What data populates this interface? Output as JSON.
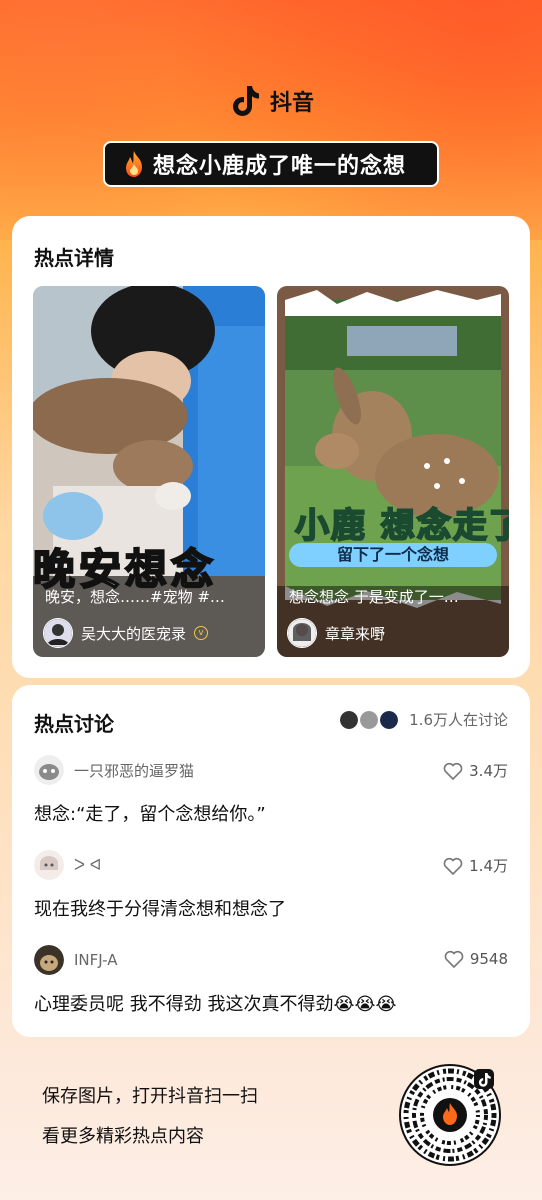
{
  "app": {
    "name": "抖音"
  },
  "topic": {
    "title": "想念小鹿成了唯一的念想"
  },
  "hot_detail": {
    "title": "热点详情",
    "videos": [
      {
        "caption": "晚安，想念……#宠物 #…",
        "overlay": "晚安想念",
        "author": "吴大大的医宠录"
      },
      {
        "caption": "想念想念 于是变成了一…",
        "overlay": "小鹿 想念走了",
        "subtitle": "留下了一个念想",
        "author": "章章来嘢"
      }
    ]
  },
  "discussion": {
    "title": "热点讨论",
    "count_text": "1.6万人在讨论",
    "comments": [
      {
        "user": "一只邪恶的逼罗猫",
        "text": "想念:“走了，留个念想给你。”",
        "likes": "3.4万"
      },
      {
        "user": "ᐳ ᐊ",
        "text": "现在我终于分得清念想和想念了",
        "likes": "1.4万"
      },
      {
        "user": "INFJ-A",
        "text": "心理委员呢 我不得劲 我这次真不得劲😭😭😭",
        "likes": "9548"
      }
    ]
  },
  "footer": {
    "line1": "保存图片，打开抖音扫一扫",
    "line2": "看更多精彩热点内容"
  },
  "colors": {
    "accent": "#ff6a2a",
    "dark": "#111111"
  }
}
